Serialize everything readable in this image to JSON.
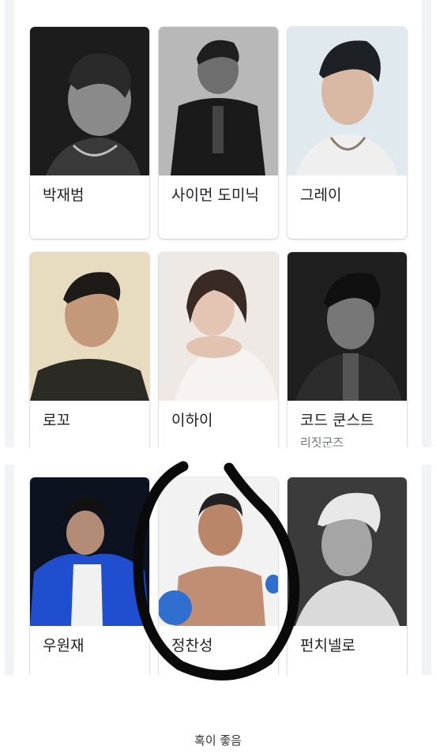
{
  "results_top": [
    {
      "name": "박재범",
      "subtitle": ""
    },
    {
      "name": "사이먼 도미닉",
      "subtitle": ""
    },
    {
      "name": "그레이",
      "subtitle": ""
    },
    {
      "name": "로꼬",
      "subtitle": ""
    },
    {
      "name": "이하이",
      "subtitle": ""
    },
    {
      "name": "코드 쿤스트",
      "subtitle": "리짓군즈"
    }
  ],
  "results_bottom": [
    {
      "name": "우원재"
    },
    {
      "name": "정찬성"
    },
    {
      "name": "펀치넬로"
    }
  ],
  "caption": "혹이 좋음"
}
